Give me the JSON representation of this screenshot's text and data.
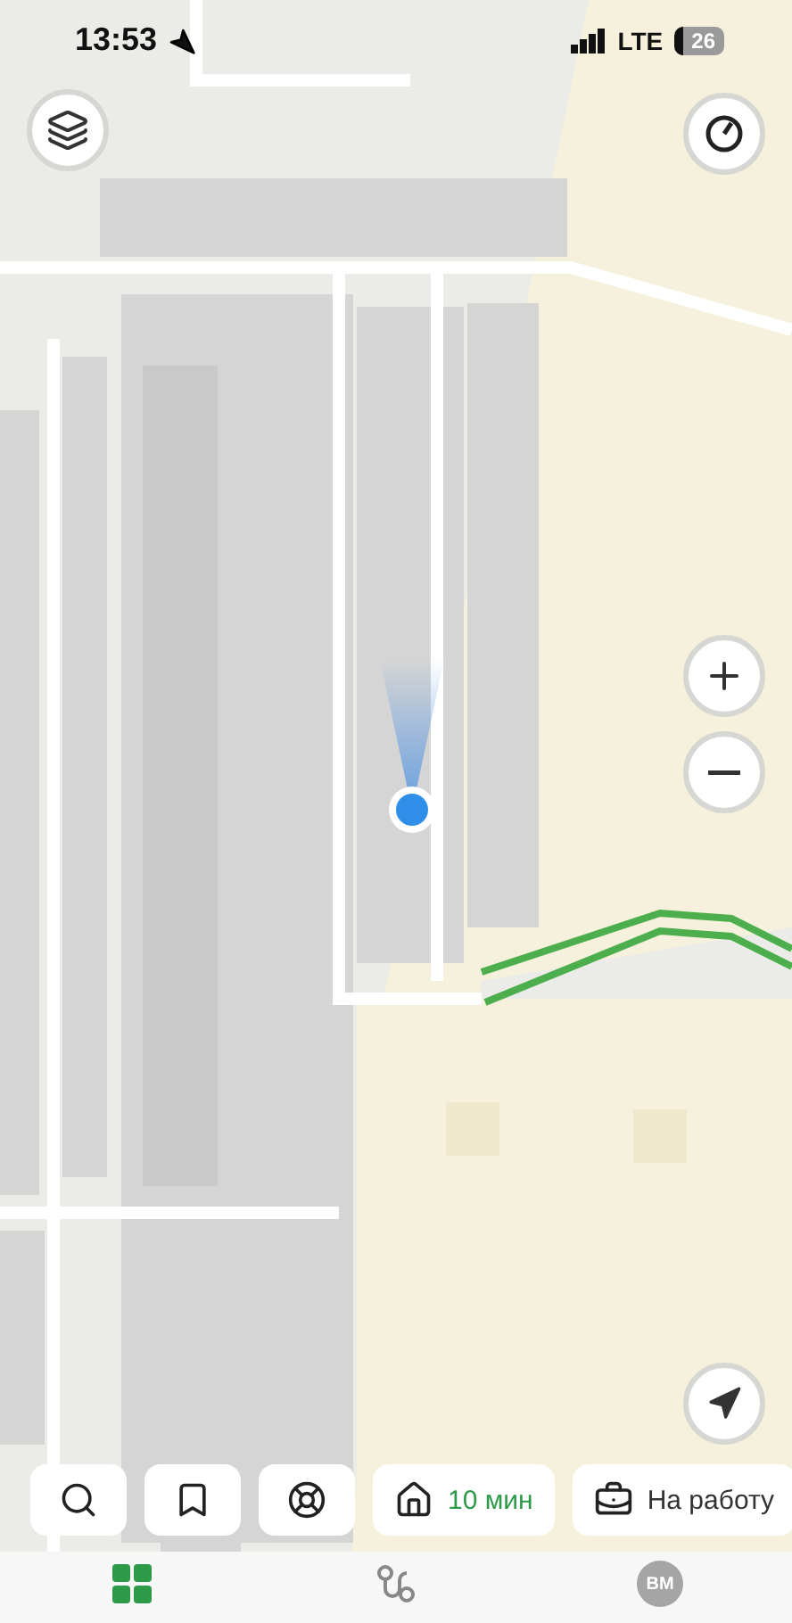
{
  "status_bar": {
    "time": "13:53",
    "network": "LTE",
    "battery": "26"
  },
  "quick_actions": [
    {
      "kind": "search"
    },
    {
      "kind": "bookmark"
    },
    {
      "kind": "wheel"
    }
  ],
  "routes": [
    {
      "kind": "home",
      "label": "10 мин",
      "highlighted": true
    },
    {
      "kind": "work",
      "label": "На работу",
      "highlighted": false
    }
  ],
  "tabs": [
    {
      "kind": "grid",
      "selected": true
    },
    {
      "kind": "route",
      "selected": false
    },
    {
      "kind": "avatar",
      "label": "ВМ",
      "selected": false
    }
  ]
}
